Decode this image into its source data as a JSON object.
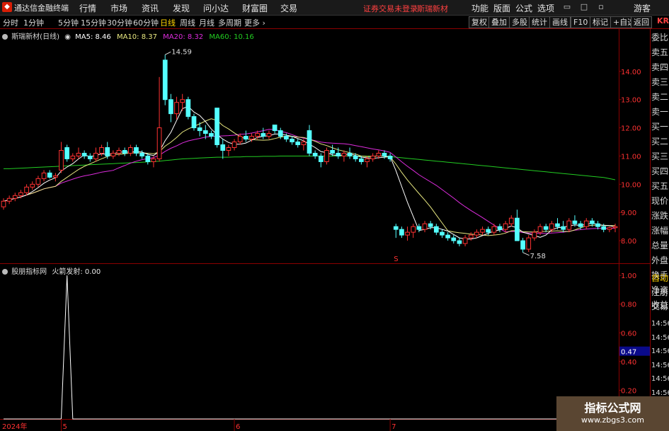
{
  "app": {
    "title": "通达信金融终端"
  },
  "menu": [
    {
      "label": "行情",
      "x": 112
    },
    {
      "label": "市场",
      "x": 156
    },
    {
      "label": "资讯",
      "x": 200
    },
    {
      "label": "发现",
      "x": 244
    },
    {
      "label": "问小达",
      "x": 287
    },
    {
      "label": "财富圈",
      "x": 342
    },
    {
      "label": "交易",
      "x": 396
    }
  ],
  "status_text": "证券交易未登录",
  "status_stock": "斯瑞新材",
  "right_menu": [
    {
      "label": "功能",
      "x": 666
    },
    {
      "label": "版面",
      "x": 697
    },
    {
      "label": "公式",
      "x": 728
    },
    {
      "label": "选项",
      "x": 759
    }
  ],
  "user": "游客",
  "periods": [
    "分时",
    "1分钟",
    "5分钟",
    "15分钟",
    "30分钟",
    "60分钟",
    "日线",
    "周线",
    "月线",
    "多周期",
    "更多"
  ],
  "active_period": "日线",
  "toolbar_buttons": [
    "复权",
    "叠加",
    "多股",
    "统计",
    "画线",
    "F10",
    "标记",
    "+自选",
    "返回"
  ],
  "kr_label": "KR",
  "main_legend": {
    "stock": "斯瑞新材(日线)",
    "ma5": "MA5: 8.46",
    "ma10": "MA10: 8.37",
    "ma20": "MA20: 8.32",
    "ma60": "MA60: 10.16"
  },
  "indicator_legend": {
    "name": "股朋指标网",
    "formula": "火箭发射: 0.00"
  },
  "right_panel": [
    "委比",
    "卖五",
    "卖四",
    "卖三",
    "卖二",
    "卖一",
    "买一",
    "买二",
    "买三",
    "买四",
    "买五",
    "现价",
    "涨跌",
    "涨幅",
    "总量",
    "外盘",
    "换手",
    "净资",
    "收益",
    "自动",
    "注册",
    "交易",
    "14:56",
    "14:56",
    "14:56",
    "14:56",
    "14:56",
    "14:56",
    "14:56"
  ],
  "colors": {
    "up": "#ff3232",
    "down": "#54ffff",
    "ma5": "#ffffff",
    "ma10": "#e8e880",
    "ma20": "#dd2cdd",
    "ma60": "#22cc22"
  },
  "chart_data": {
    "type": "candlestick",
    "y_ticks": [
      "14.00",
      "13.00",
      "12.00",
      "11.00",
      "10.00",
      "9.00",
      "8.00"
    ],
    "y_tick_values": [
      14,
      13,
      12,
      11,
      10,
      9,
      8
    ],
    "ylim": [
      7.2,
      15.2
    ],
    "high_label": "14.59",
    "low_label": "7.58",
    "ind_ticks": [
      "1.00",
      "0.80",
      "0.60",
      "0.40",
      "0.20"
    ],
    "ind_tick_values": [
      1.0,
      0.8,
      0.6,
      0.4,
      0.2
    ],
    "ind_ylim": [
      0,
      1.05
    ],
    "current_label": "0.47",
    "current_value": 0.47,
    "x_labels": [
      "2024年",
      "5",
      "6",
      "7"
    ],
    "x_label_index": [
      0,
      10,
      40,
      67
    ],
    "s_index": 68,
    "signal": [
      0,
      0,
      0,
      0,
      0,
      0,
      0,
      0,
      0,
      0,
      0,
      1,
      0,
      0,
      0,
      0,
      0,
      0,
      0,
      0,
      0,
      0,
      0,
      0,
      0,
      0,
      0,
      0,
      0,
      0,
      0,
      0,
      0,
      0,
      0,
      0,
      0,
      0,
      0,
      0,
      0,
      0,
      0,
      0,
      0,
      0,
      0,
      0,
      0,
      0,
      0,
      0,
      0,
      0,
      0,
      0,
      0,
      0,
      0,
      0,
      0,
      0,
      0,
      0,
      0,
      0,
      0,
      0,
      0,
      0,
      0,
      0,
      0,
      0,
      0,
      0,
      0,
      0,
      0,
      0,
      0,
      0,
      0,
      0,
      0,
      0,
      0,
      0,
      0,
      0,
      0,
      0,
      0,
      0,
      0,
      0,
      0,
      0,
      0,
      0,
      0,
      0,
      0,
      0,
      0,
      0,
      0,
      0
    ],
    "ohlc": [
      [
        9.2,
        9.5,
        9.1,
        9.4
      ],
      [
        9.4,
        9.6,
        9.3,
        9.5
      ],
      [
        9.5,
        9.7,
        9.4,
        9.6
      ],
      [
        9.6,
        9.8,
        9.5,
        9.7
      ],
      [
        9.7,
        10.0,
        9.6,
        9.9
      ],
      [
        9.9,
        10.1,
        9.8,
        10.0
      ],
      [
        10.0,
        10.3,
        9.9,
        10.2
      ],
      [
        10.2,
        10.5,
        10.1,
        10.4
      ],
      [
        10.4,
        10.5,
        10.2,
        10.25
      ],
      [
        10.25,
        10.4,
        10.1,
        10.3
      ],
      [
        10.5,
        11.5,
        10.4,
        11.2
      ],
      [
        11.3,
        11.4,
        10.8,
        10.9
      ],
      [
        10.9,
        11.1,
        10.8,
        11.0
      ],
      [
        11.0,
        11.3,
        10.9,
        11.1
      ],
      [
        11.1,
        11.2,
        10.9,
        11.0
      ],
      [
        11.0,
        11.1,
        10.8,
        10.9
      ],
      [
        10.9,
        11.3,
        10.8,
        11.1
      ],
      [
        11.1,
        11.4,
        11.0,
        11.3
      ],
      [
        11.3,
        11.5,
        10.9,
        11.0
      ],
      [
        11.0,
        11.2,
        10.9,
        11.1
      ],
      [
        11.1,
        11.3,
        11.0,
        11.2
      ],
      [
        11.2,
        11.3,
        11.0,
        11.1
      ],
      [
        11.1,
        11.4,
        11.0,
        11.3
      ],
      [
        11.3,
        11.4,
        11.0,
        11.1
      ],
      [
        11.1,
        11.2,
        10.9,
        11.0
      ],
      [
        11.0,
        11.1,
        10.7,
        10.8
      ],
      [
        10.8,
        11.0,
        10.6,
        10.9
      ],
      [
        10.9,
        13.8,
        10.8,
        12.0
      ],
      [
        14.4,
        14.59,
        12.8,
        13.0
      ],
      [
        13.0,
        13.2,
        12.2,
        12.5
      ],
      [
        12.5,
        13.1,
        12.3,
        12.9
      ],
      [
        12.9,
        13.2,
        12.6,
        13.0
      ],
      [
        13.0,
        13.1,
        12.3,
        12.4
      ],
      [
        12.4,
        12.5,
        11.9,
        12.0
      ],
      [
        12.0,
        12.2,
        11.7,
        11.9
      ],
      [
        11.9,
        12.1,
        11.6,
        11.8
      ],
      [
        11.8,
        11.9,
        11.6,
        11.7
      ],
      [
        12.7,
        12.7,
        11.3,
        11.4
      ],
      [
        11.4,
        11.6,
        10.9,
        11.2
      ],
      [
        11.2,
        11.4,
        11.0,
        11.3
      ],
      [
        11.3,
        11.6,
        11.2,
        11.5
      ],
      [
        11.5,
        11.8,
        11.4,
        11.7
      ],
      [
        11.7,
        11.9,
        11.5,
        11.6
      ],
      [
        11.6,
        11.8,
        11.5,
        11.7
      ],
      [
        11.7,
        11.9,
        11.6,
        11.8
      ],
      [
        11.8,
        12.0,
        11.6,
        11.7
      ],
      [
        11.7,
        11.9,
        11.6,
        11.8
      ],
      [
        12.1,
        12.1,
        11.8,
        11.9
      ],
      [
        11.9,
        12.0,
        11.6,
        11.7
      ],
      [
        11.7,
        11.8,
        11.5,
        11.6
      ],
      [
        11.6,
        11.7,
        11.4,
        11.5
      ],
      [
        11.5,
        11.6,
        11.3,
        11.4
      ],
      [
        11.4,
        11.6,
        11.2,
        11.5
      ],
      [
        11.9,
        12.1,
        11.0,
        11.1
      ],
      [
        11.1,
        11.2,
        10.9,
        11.0
      ],
      [
        11.0,
        11.1,
        10.6,
        10.8
      ],
      [
        10.8,
        11.3,
        10.7,
        11.2
      ],
      [
        11.2,
        11.4,
        11.0,
        11.1
      ],
      [
        11.1,
        11.3,
        10.9,
        11.0
      ],
      [
        11.0,
        11.2,
        10.8,
        11.1
      ],
      [
        11.1,
        11.3,
        10.9,
        11.0
      ],
      [
        11.0,
        11.1,
        10.8,
        10.9
      ],
      [
        10.9,
        11.0,
        10.7,
        10.8
      ],
      [
        10.8,
        11.0,
        10.6,
        10.9
      ],
      [
        10.9,
        11.1,
        10.8,
        11.0
      ],
      [
        11.0,
        11.2,
        10.9,
        11.1
      ],
      [
        11.1,
        11.2,
        10.9,
        11.0
      ],
      [
        11.0,
        11.1,
        10.8,
        10.9
      ],
      [
        8.5,
        8.6,
        8.1,
        8.4
      ],
      [
        8.4,
        8.5,
        8.1,
        8.2
      ],
      [
        8.2,
        8.5,
        8.0,
        8.3
      ],
      [
        8.3,
        8.6,
        8.1,
        8.5
      ],
      [
        8.5,
        8.6,
        8.3,
        8.4
      ],
      [
        8.4,
        8.7,
        8.3,
        8.6
      ],
      [
        8.6,
        8.7,
        8.4,
        8.5
      ],
      [
        8.5,
        8.6,
        8.2,
        8.3
      ],
      [
        8.3,
        8.4,
        8.1,
        8.2
      ],
      [
        8.2,
        8.3,
        8.0,
        8.1
      ],
      [
        8.1,
        8.2,
        7.9,
        8.0
      ],
      [
        8.0,
        8.1,
        7.8,
        7.9
      ],
      [
        7.9,
        8.2,
        7.8,
        8.1
      ],
      [
        8.1,
        8.3,
        8.0,
        8.2
      ],
      [
        8.2,
        8.4,
        8.1,
        8.3
      ],
      [
        8.3,
        8.5,
        8.2,
        8.4
      ],
      [
        8.4,
        8.5,
        8.2,
        8.3
      ],
      [
        8.3,
        8.6,
        8.2,
        8.5
      ],
      [
        8.5,
        8.6,
        8.3,
        8.4
      ],
      [
        8.4,
        8.7,
        8.3,
        8.6
      ],
      [
        8.6,
        8.9,
        8.5,
        8.8
      ],
      [
        8.8,
        9.1,
        8.0,
        8.0
      ],
      [
        8.0,
        8.1,
        7.58,
        7.7
      ],
      [
        7.7,
        8.2,
        7.6,
        8.1
      ],
      [
        8.1,
        8.4,
        8.0,
        8.3
      ],
      [
        8.3,
        8.6,
        8.2,
        8.5
      ],
      [
        8.5,
        8.6,
        8.3,
        8.4
      ],
      [
        8.4,
        8.7,
        8.3,
        8.6
      ],
      [
        8.6,
        8.8,
        8.4,
        8.5
      ],
      [
        8.5,
        8.7,
        8.3,
        8.4
      ],
      [
        8.4,
        8.8,
        8.3,
        8.7
      ],
      [
        8.7,
        8.9,
        8.5,
        8.6
      ],
      [
        8.6,
        8.7,
        8.4,
        8.5
      ],
      [
        8.5,
        8.8,
        8.4,
        8.7
      ],
      [
        8.7,
        8.8,
        8.5,
        8.6
      ],
      [
        8.6,
        8.7,
        8.4,
        8.5
      ],
      [
        8.5,
        8.6,
        8.3,
        8.4
      ],
      [
        8.4,
        8.5,
        8.3,
        8.46
      ],
      [
        8.46,
        8.6,
        8.3,
        8.5
      ]
    ],
    "ma60": [
      10.55,
      10.55,
      10.56,
      10.57,
      10.58,
      10.59,
      10.6,
      10.61,
      10.62,
      10.63,
      10.64,
      10.65,
      10.66,
      10.67,
      10.68,
      10.69,
      10.7,
      10.71,
      10.72,
      10.73,
      10.74,
      10.75,
      10.76,
      10.77,
      10.78,
      10.79,
      10.8,
      10.82,
      10.84,
      10.86,
      10.88,
      10.9,
      10.91,
      10.92,
      10.93,
      10.94,
      10.95,
      10.96,
      10.96,
      10.96,
      10.97,
      10.97,
      10.98,
      10.98,
      10.98,
      10.99,
      10.99,
      10.99,
      11.0,
      11.0,
      11.0,
      11.0,
      11.0,
      11.0,
      11.0,
      11.0,
      11.0,
      11.0,
      11.0,
      11.0,
      11.0,
      11.0,
      11.0,
      11.0,
      11.0,
      11.0,
      11.0,
      10.98,
      10.96,
      10.94,
      10.92,
      10.9,
      10.88,
      10.86,
      10.84,
      10.82,
      10.8,
      10.78,
      10.76,
      10.74,
      10.72,
      10.7,
      10.68,
      10.66,
      10.64,
      10.62,
      10.6,
      10.58,
      10.56,
      10.54,
      10.52,
      10.5,
      10.48,
      10.46,
      10.44,
      10.42,
      10.4,
      10.38,
      10.36,
      10.34,
      10.32,
      10.3,
      10.28,
      10.26,
      10.24,
      10.2,
      10.16
    ]
  }
}
